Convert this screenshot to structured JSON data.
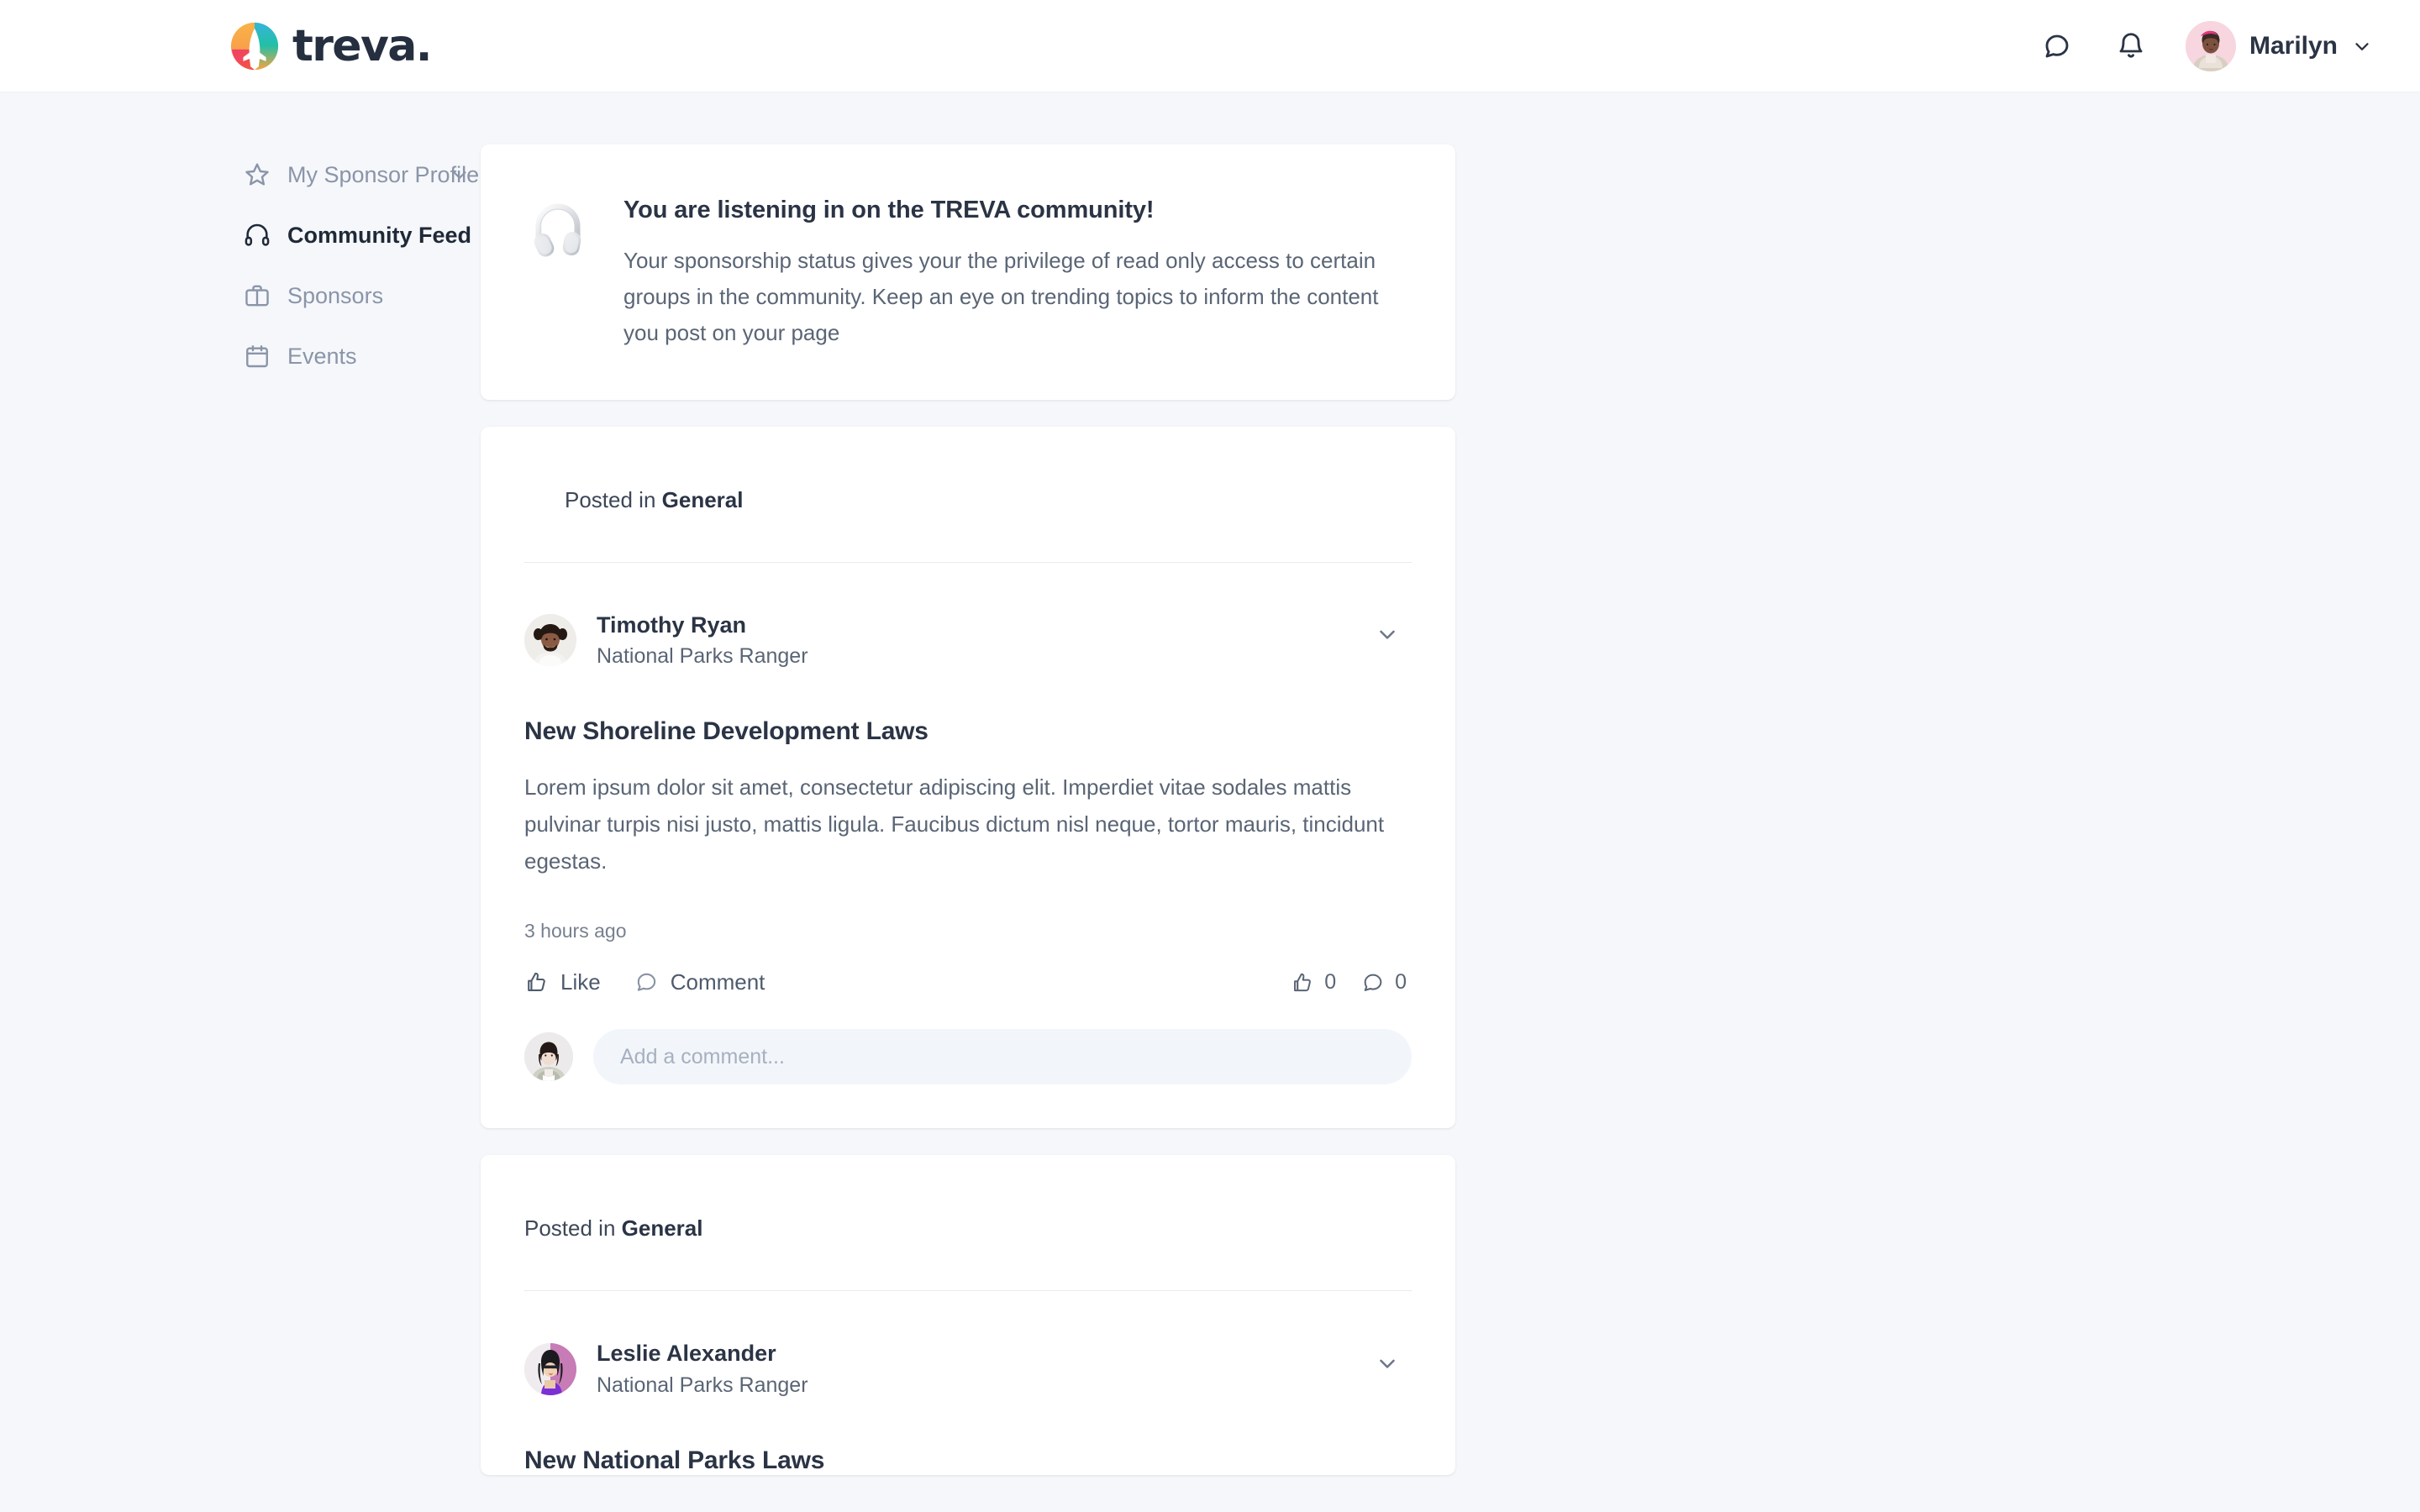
{
  "brand": {
    "word": "treva.",
    "logo_icon": "treva-leaf-plane-logo",
    "colors": {
      "orange": "#f9a94c",
      "teal": "#2bb8a5",
      "blue": "#3bb1d6",
      "pink": "#ec3a7c",
      "red": "#f4533d"
    }
  },
  "header": {
    "messages_icon": "chat-bubble-icon",
    "notifications_icon": "bell-icon",
    "user_name": "Marilyn",
    "user_avatar": "marilyn-avatar",
    "user_chevron_icon": "chevron-down-icon"
  },
  "sidebar": {
    "items": [
      {
        "label": "My Sponsor Profile",
        "icon": "star-icon",
        "active": false,
        "has_chevron": true
      },
      {
        "label": "Community Feed",
        "icon": "headphones-icon",
        "active": true,
        "has_chevron": false
      },
      {
        "label": "Sponsors",
        "icon": "briefcase-icon",
        "active": false,
        "has_chevron": false
      },
      {
        "label": "Events",
        "icon": "calendar-icon",
        "active": false,
        "has_chevron": false
      }
    ]
  },
  "banner": {
    "icon": "silver-headphones-image",
    "title": "You are listening in on the TREVA community!",
    "body": "Your sponsorship status gives your the privilege of read only access to certain groups in the community. Keep an eye on trending topics to inform the content you post on your page"
  },
  "posts": [
    {
      "posted_in_prefix": "Posted in ",
      "posted_in_group": "General",
      "author_name": "Timothy Ryan",
      "author_role": "National Parks Ranger",
      "author_avatar": "timothy-ryan-avatar",
      "menu_icon": "chevron-down-icon",
      "title": "New Shoreline Development Laws",
      "body": "Lorem ipsum dolor sit amet, consectetur adipiscing elit. Imperdiet vitae sodales mattis pulvinar turpis nisi justo, mattis ligula. Faucibus dictum nisl neque, tortor mauris, tincidunt egestas.",
      "time": "3 hours ago",
      "like_label": "Like",
      "like_icon": "thumbs-up-icon",
      "comment_label": "Comment",
      "comment_icon": "speech-bubble-icon",
      "like_count": "0",
      "comment_count": "0",
      "comment_placeholder": "Add a comment...",
      "comment_avatar": "marilyn-comment-avatar"
    },
    {
      "posted_in_prefix": "Posted in ",
      "posted_in_group": "General",
      "author_name": "Leslie Alexander",
      "author_role": "National Parks Ranger",
      "author_avatar": "leslie-alexander-avatar",
      "menu_icon": "chevron-down-icon",
      "title": "New National Parks Laws"
    }
  ]
}
